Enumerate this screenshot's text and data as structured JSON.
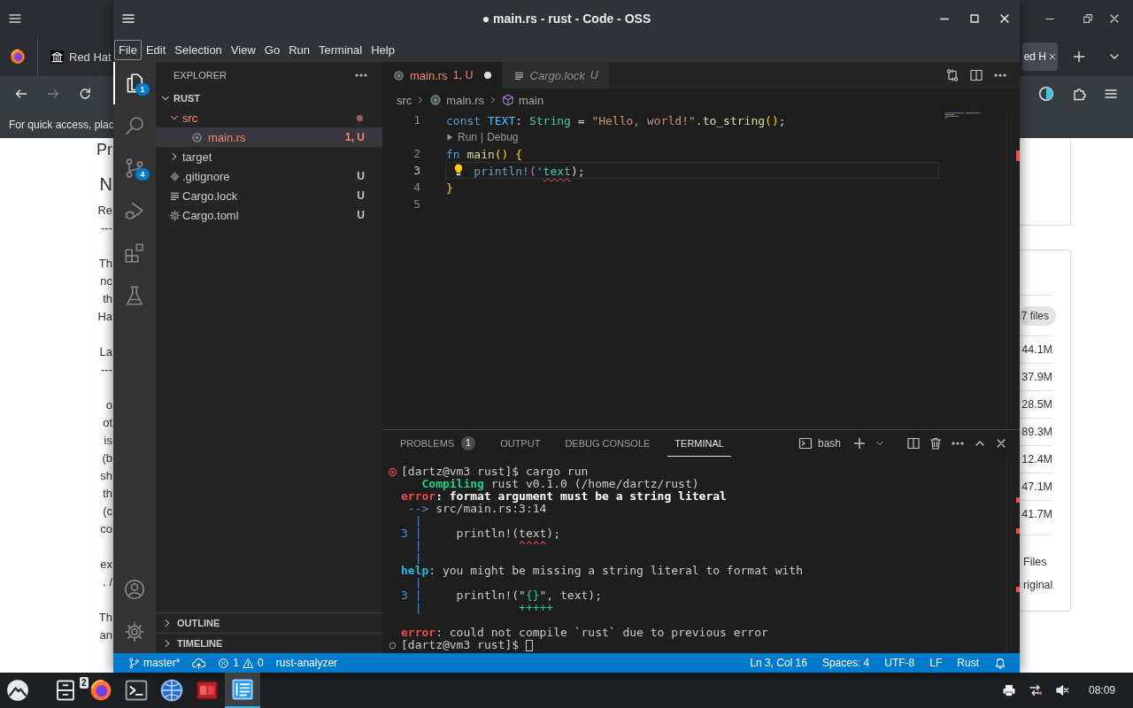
{
  "browser": {
    "tabs": [
      {
        "label": "Red Hat",
        "selected": false
      },
      {
        "label": "ed H",
        "selected": true
      }
    ],
    "nav": [
      {
        "kind": "back",
        "disabled": false
      },
      {
        "kind": "forward",
        "disabled": true
      },
      {
        "kind": "reload",
        "disabled": false
      }
    ],
    "bookmarks_hint": "For quick access, plac",
    "page_left": [
      {
        "kind": "title",
        "lines": [
          "Pr"
        ]
      },
      {
        "kind": "heading",
        "lines": [
          "N"
        ]
      },
      {
        "kind": "text",
        "lines": [
          "Re",
          "---"
        ]
      },
      {
        "kind": "text",
        "lines": [
          "Th",
          "nc",
          "th",
          "Ha"
        ]
      },
      {
        "kind": "section",
        "lines": [
          "La",
          "---"
        ]
      },
      {
        "kind": "text",
        "lines": [
          "o",
          "ot",
          "is",
          "(b",
          "sh",
          "th",
          "(c",
          "co"
        ]
      },
      {
        "kind": "text",
        "lines": [
          "ex",
          ". /"
        ]
      },
      {
        "kind": "text",
        "lines": [
          "Th",
          "an"
        ]
      }
    ],
    "page_right": {
      "pill": "7 files",
      "sizes": [
        "44.1M",
        "37.9M",
        "28.5M",
        "89.3M",
        "12.4M",
        "47.1M",
        "41.7M"
      ],
      "footer": [
        "Files",
        "riginal"
      ]
    }
  },
  "editor_window": {
    "title": "● main.rs - rust - Code - OSS",
    "menu": [
      {
        "label": "File",
        "focused": true
      },
      {
        "label": "Edit",
        "focused": false
      },
      {
        "label": "Selection",
        "focused": false
      },
      {
        "label": "View",
        "focused": false
      },
      {
        "label": "Go",
        "focused": false
      },
      {
        "label": "Run",
        "focused": false
      },
      {
        "label": "Terminal",
        "focused": false
      },
      {
        "label": "Help",
        "focused": false
      }
    ],
    "activity_bar": [
      {
        "kind": "explorer",
        "selected": true,
        "badge": "1"
      },
      {
        "kind": "search",
        "selected": false
      },
      {
        "kind": "source_control",
        "selected": false,
        "badge": "4"
      },
      {
        "kind": "run",
        "selected": false
      },
      {
        "kind": "extensions",
        "selected": false
      },
      {
        "kind": "testing",
        "selected": false
      }
    ],
    "activity_bottom": [
      {
        "kind": "accounts"
      },
      {
        "kind": "settings"
      }
    ],
    "explorer": {
      "title": "EXPLORER",
      "tree": [
        {
          "label": "RUST",
          "kind": "root",
          "expanded": true,
          "selected": false,
          "problem": false,
          "children": [
            {
              "label": "src",
              "kind": "folder",
              "expanded": true,
              "selected": false,
              "problem": true,
              "children": [
                {
                  "label": "main.rs",
                  "kind": "rust",
                  "selected": true,
                  "problem": true,
                  "decoration": "1, U"
                }
              ]
            },
            {
              "label": "target",
              "kind": "folder",
              "expanded": false,
              "selected": false,
              "problem": false
            },
            {
              "label": ".gitignore",
              "kind": "git",
              "selected": false,
              "problem": false,
              "decoration": "U"
            },
            {
              "label": "Cargo.lock",
              "kind": "text",
              "selected": false,
              "problem": false,
              "decoration": "U"
            },
            {
              "label": "Cargo.toml",
              "kind": "config",
              "selected": false,
              "problem": false,
              "decoration": "U"
            }
          ]
        }
      ],
      "sections": [
        {
          "label": "OUTLINE",
          "expanded": false
        },
        {
          "label": "TIMELINE",
          "expanded": false
        }
      ]
    },
    "tabs": [
      {
        "label": "main.rs",
        "kind": "rust",
        "decoration": "1, U",
        "selected": true,
        "problem": true,
        "dirty": true,
        "preview": false
      },
      {
        "label": "Cargo.lock",
        "kind": "text",
        "decoration": "U",
        "selected": false,
        "problem": false,
        "dirty": false,
        "preview": true
      }
    ],
    "breadcrumbs": [
      {
        "label": "src",
        "kind": "folder"
      },
      {
        "label": "main.rs",
        "kind": "rust"
      },
      {
        "label": "main",
        "kind": "function"
      }
    ],
    "code": {
      "lines": [
        {
          "kind": "code",
          "number": "1",
          "current": false,
          "tokens": [
            {
              "text": "const",
              "kind": "kw"
            },
            {
              "text": " TEXT",
              "kind": "const"
            },
            {
              "text": ": ",
              "kind": "punct"
            },
            {
              "text": "String",
              "kind": "type"
            },
            {
              "text": " = ",
              "kind": "punct"
            },
            {
              "text": "\"Hello, world!\"",
              "kind": "str"
            },
            {
              "text": ".",
              "kind": "punct"
            },
            {
              "text": "to_string",
              "kind": "fn"
            },
            {
              "text": "()",
              "kind": "bracket"
            },
            {
              "text": ";",
              "kind": "punct"
            }
          ]
        },
        {
          "kind": "codelens",
          "links": [
            "Run",
            "Debug"
          ],
          "separator": "|"
        },
        {
          "kind": "code",
          "number": "2",
          "current": false,
          "tokens": [
            {
              "text": "fn",
              "kind": "kw"
            },
            {
              "text": " main",
              "kind": "fn"
            },
            {
              "text": "()",
              "kind": "bracket"
            },
            {
              "text": " {",
              "kind": "bracket"
            }
          ]
        },
        {
          "kind": "code",
          "number": "3",
          "current": true,
          "lightbulb": true,
          "tokens": [
            {
              "text": "    println!",
              "kind": "macro"
            },
            {
              "text": "(",
              "kind": "bracket2"
            },
            {
              "text": "'",
              "kind": "lifetime"
            },
            {
              "text": "text",
              "kind": "lifetime",
              "error": true
            },
            {
              "text": ");",
              "kind": "punct"
            }
          ]
        },
        {
          "kind": "code",
          "number": "4",
          "current": false,
          "tokens": [
            {
              "text": "}",
              "kind": "bracket"
            }
          ]
        },
        {
          "kind": "code",
          "number": "5",
          "current": false
        }
      ]
    },
    "panel": {
      "tabs": [
        {
          "label": "PROBLEMS",
          "badge": "1",
          "selected": false
        },
        {
          "label": "OUTPUT",
          "selected": false
        },
        {
          "label": "DEBUG CONSOLE",
          "selected": false
        },
        {
          "label": "TERMINAL",
          "selected": true
        }
      ],
      "shell": "bash",
      "terminal": [
        {
          "kind": "failed_command",
          "cursor": false,
          "segments": [
            {
              "text": "[dartz@vm3 rust]$ cargo run",
              "kind": "plain"
            }
          ]
        },
        {
          "kind": "line",
          "cursor": false,
          "segments": [
            {
              "text": "   Compiling",
              "kind": "ok"
            },
            {
              "text": " rust v0.1.0 (/home/dartz/rust)",
              "kind": "plain"
            }
          ]
        },
        {
          "kind": "line",
          "cursor": false,
          "segments": [
            {
              "text": "error",
              "kind": "err"
            },
            {
              "text": ": format argument must be a string literal",
              "kind": "strong"
            }
          ]
        },
        {
          "kind": "line",
          "cursor": false,
          "segments": [
            {
              "text": " -->",
              "kind": "info"
            },
            {
              "text": " src/main.rs:3:14",
              "kind": "plain"
            }
          ]
        },
        {
          "kind": "line",
          "cursor": false,
          "segments": [
            {
              "text": "  |",
              "kind": "info"
            }
          ]
        },
        {
          "kind": "line",
          "cursor": false,
          "segments": [
            {
              "text": "3 |",
              "kind": "info"
            },
            {
              "text": "     println!(text);",
              "kind": "plain"
            }
          ]
        },
        {
          "kind": "line",
          "cursor": false,
          "segments": [
            {
              "text": "  |",
              "kind": "info"
            },
            {
              "text": "              ^^^^",
              "kind": "mark"
            }
          ]
        },
        {
          "kind": "line",
          "cursor": false,
          "segments": [
            {
              "text": "  |",
              "kind": "info"
            }
          ]
        },
        {
          "kind": "line",
          "cursor": false,
          "segments": [
            {
              "text": "help",
              "kind": "help"
            },
            {
              "text": ": you might be missing a string literal to format with",
              "kind": "plain"
            }
          ]
        },
        {
          "kind": "line",
          "cursor": false,
          "segments": [
            {
              "text": "  |",
              "kind": "info"
            }
          ]
        },
        {
          "kind": "line",
          "cursor": false,
          "segments": [
            {
              "text": "3 |",
              "kind": "info"
            },
            {
              "text": "     println!(\"",
              "kind": "plain"
            },
            {
              "text": "{}",
              "kind": "add"
            },
            {
              "text": "\", text);",
              "kind": "plain"
            }
          ]
        },
        {
          "kind": "line",
          "cursor": false,
          "segments": [
            {
              "text": "  |",
              "kind": "info"
            },
            {
              "text": "              +++++",
              "kind": "add"
            }
          ]
        },
        {
          "kind": "blank"
        },
        {
          "kind": "line",
          "cursor": false,
          "segments": [
            {
              "text": "error",
              "kind": "err"
            },
            {
              "text": ": could not compile `rust` due to previous error",
              "kind": "plain"
            }
          ]
        },
        {
          "kind": "command",
          "cursor": true,
          "segments": [
            {
              "text": "[dartz@vm3 rust]$ ",
              "kind": "plain"
            }
          ]
        }
      ]
    },
    "status_bar": {
      "left": [
        {
          "kind": "branch",
          "text": "master*"
        },
        {
          "kind": "sync"
        },
        {
          "kind": "problems",
          "errors": "1",
          "warnings": "0"
        },
        {
          "kind": "text",
          "text": "rust-analyzer"
        }
      ],
      "right": [
        {
          "kind": "text",
          "text": "Ln 3, Col 16"
        },
        {
          "kind": "text",
          "text": "Spaces: 4"
        },
        {
          "kind": "text",
          "text": "UTF-8"
        },
        {
          "kind": "text",
          "text": "LF"
        },
        {
          "kind": "text",
          "text": "Rust"
        },
        {
          "kind": "bell"
        }
      ]
    }
  },
  "taskbar": {
    "apps": [
      {
        "kind": "launcher",
        "selected": false
      },
      {
        "kind": "files",
        "selected": false
      },
      {
        "kind": "browser",
        "selected": false,
        "badge": "2"
      },
      {
        "kind": "terminal",
        "selected": false
      },
      {
        "kind": "globe",
        "selected": false
      },
      {
        "kind": "red_app",
        "selected": false
      },
      {
        "kind": "editor",
        "selected": true
      }
    ],
    "tray": [
      {
        "kind": "printer"
      },
      {
        "kind": "network"
      },
      {
        "kind": "volume_muted"
      }
    ],
    "clock": "08:09"
  }
}
